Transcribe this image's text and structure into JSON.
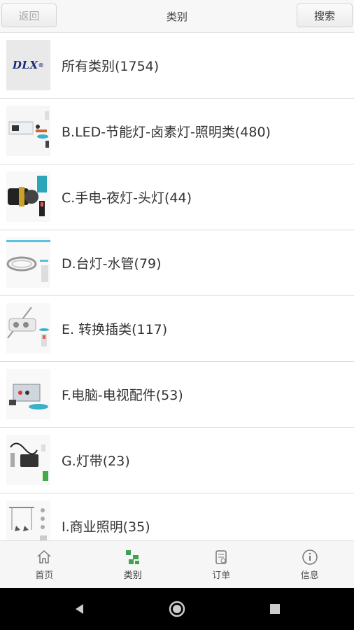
{
  "header": {
    "back_label": "返回",
    "title": "类别",
    "search_label": "搜索"
  },
  "categories": [
    {
      "label": "所有类别(1754)",
      "thumb": "dlx-logo",
      "logo_text": "DLX"
    },
    {
      "label": "B.LED-节能灯-卤素灯-照明类(480)",
      "thumb": "led-product-photo"
    },
    {
      "label": "C.手电-夜灯-头灯(44)",
      "thumb": "flashlight-photo"
    },
    {
      "label": "D.台灯-水管(79)",
      "thumb": "led-tube-photo"
    },
    {
      "label": "E. 转换插类(117)",
      "thumb": "power-strip-photo"
    },
    {
      "label": "F.电脑-电视配件(53)",
      "thumb": "computer-accessory-photo"
    },
    {
      "label": "G.灯带(23)",
      "thumb": "light-strip-photo"
    },
    {
      "label": "I.商业照明(35)",
      "thumb": "commercial-lighting-photo"
    }
  ],
  "tabs": [
    {
      "label": "首页",
      "icon": "home-icon",
      "active": false
    },
    {
      "label": "类别",
      "icon": "category-icon",
      "active": true,
      "color": "#4caf50"
    },
    {
      "label": "订单",
      "icon": "order-icon",
      "active": false
    },
    {
      "label": "信息",
      "icon": "info-icon",
      "active": false
    }
  ],
  "android_nav": [
    "back-triangle-icon",
    "home-circle-icon",
    "recents-square-icon"
  ]
}
